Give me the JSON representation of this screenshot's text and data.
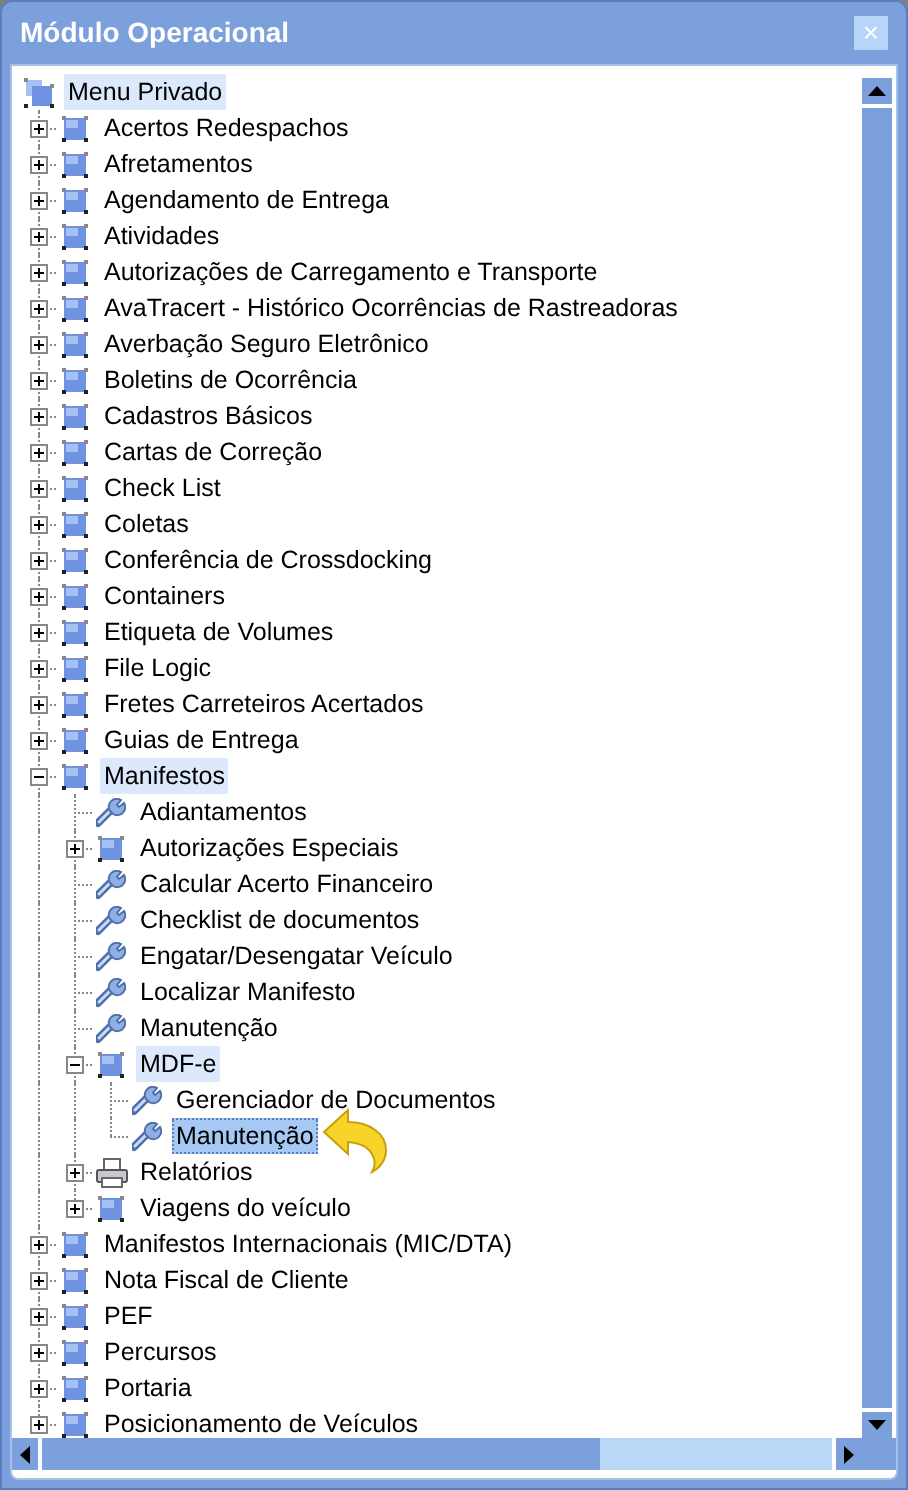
{
  "window": {
    "title": "Módulo Operacional",
    "close": "×"
  },
  "tree": {
    "label": "Menu Privado",
    "highlighted": true,
    "selected": false,
    "children": [
      {
        "label": "Acertos Redespachos",
        "kind": "folder",
        "expanded": false,
        "highlighted": false,
        "selected": false
      },
      {
        "label": "Afretamentos",
        "kind": "folder",
        "expanded": false,
        "highlighted": false,
        "selected": false
      },
      {
        "label": "Agendamento de Entrega",
        "kind": "folder",
        "expanded": false,
        "highlighted": false,
        "selected": false
      },
      {
        "label": "Atividades",
        "kind": "folder",
        "expanded": false,
        "highlighted": false,
        "selected": false
      },
      {
        "label": "Autorizações de Carregamento e Transporte",
        "kind": "folder",
        "expanded": false,
        "highlighted": false,
        "selected": false
      },
      {
        "label": "AvaTracert - Histórico Ocorrências de Rastreadoras",
        "kind": "folder",
        "expanded": false,
        "highlighted": false,
        "selected": false
      },
      {
        "label": "Averbação Seguro Eletrônico",
        "kind": "folder",
        "expanded": false,
        "highlighted": false,
        "selected": false
      },
      {
        "label": "Boletins de Ocorrência",
        "kind": "folder",
        "expanded": false,
        "highlighted": false,
        "selected": false
      },
      {
        "label": "Cadastros Básicos",
        "kind": "folder",
        "expanded": false,
        "highlighted": false,
        "selected": false
      },
      {
        "label": "Cartas de Correção",
        "kind": "folder",
        "expanded": false,
        "highlighted": false,
        "selected": false
      },
      {
        "label": "Check List",
        "kind": "folder",
        "expanded": false,
        "highlighted": false,
        "selected": false
      },
      {
        "label": "Coletas",
        "kind": "folder",
        "expanded": false,
        "highlighted": false,
        "selected": false
      },
      {
        "label": "Conferência de Crossdocking",
        "kind": "folder",
        "expanded": false,
        "highlighted": false,
        "selected": false
      },
      {
        "label": "Containers",
        "kind": "folder",
        "expanded": false,
        "highlighted": false,
        "selected": false
      },
      {
        "label": "Etiqueta de Volumes",
        "kind": "folder",
        "expanded": false,
        "highlighted": false,
        "selected": false
      },
      {
        "label": "File Logic",
        "kind": "folder",
        "expanded": false,
        "highlighted": false,
        "selected": false
      },
      {
        "label": "Fretes Carreteiros Acertados",
        "kind": "folder",
        "expanded": false,
        "highlighted": false,
        "selected": false
      },
      {
        "label": "Guias de Entrega",
        "kind": "folder",
        "expanded": false,
        "highlighted": false,
        "selected": false
      },
      {
        "label": "Manifestos",
        "kind": "folder",
        "expanded": true,
        "highlighted": true,
        "selected": false,
        "children": [
          {
            "label": "Adiantamentos",
            "kind": "wrench",
            "highlighted": false,
            "selected": false
          },
          {
            "label": "Autorizações Especiais",
            "kind": "folder",
            "expanded": false,
            "highlighted": false,
            "selected": false
          },
          {
            "label": "Calcular Acerto Financeiro",
            "kind": "wrench",
            "highlighted": false,
            "selected": false
          },
          {
            "label": "Checklist de documentos",
            "kind": "wrench",
            "highlighted": false,
            "selected": false
          },
          {
            "label": "Engatar/Desengatar Veículo",
            "kind": "wrench",
            "highlighted": false,
            "selected": false
          },
          {
            "label": "Localizar Manifesto",
            "kind": "wrench",
            "highlighted": false,
            "selected": false
          },
          {
            "label": "Manutenção",
            "kind": "wrench",
            "highlighted": false,
            "selected": false
          },
          {
            "label": "MDF-e",
            "kind": "folder",
            "expanded": true,
            "highlighted": true,
            "selected": false,
            "children": [
              {
                "label": "Gerenciador de Documentos",
                "kind": "wrench",
                "highlighted": false,
                "selected": false
              },
              {
                "label": "Manutenção",
                "kind": "wrench",
                "highlighted": false,
                "selected": true
              }
            ]
          },
          {
            "label": "Relatórios",
            "kind": "printer",
            "expanded": false,
            "highlighted": false,
            "selected": false
          },
          {
            "label": "Viagens do veículo",
            "kind": "folder",
            "expanded": false,
            "highlighted": false,
            "selected": false
          }
        ]
      },
      {
        "label": "Manifestos Internacionais (MIC/DTA)",
        "kind": "folder",
        "expanded": false,
        "highlighted": false,
        "selected": false
      },
      {
        "label": "Nota Fiscal de Cliente",
        "kind": "folder",
        "expanded": false,
        "highlighted": false,
        "selected": false
      },
      {
        "label": "PEF",
        "kind": "folder",
        "expanded": false,
        "highlighted": false,
        "selected": false
      },
      {
        "label": "Percursos",
        "kind": "folder",
        "expanded": false,
        "highlighted": false,
        "selected": false
      },
      {
        "label": "Portaria",
        "kind": "folder",
        "expanded": false,
        "highlighted": false,
        "selected": false
      },
      {
        "label": "Posicionamento de Veículos",
        "kind": "folder",
        "expanded": false,
        "highlighted": false,
        "selected": false
      }
    ]
  }
}
